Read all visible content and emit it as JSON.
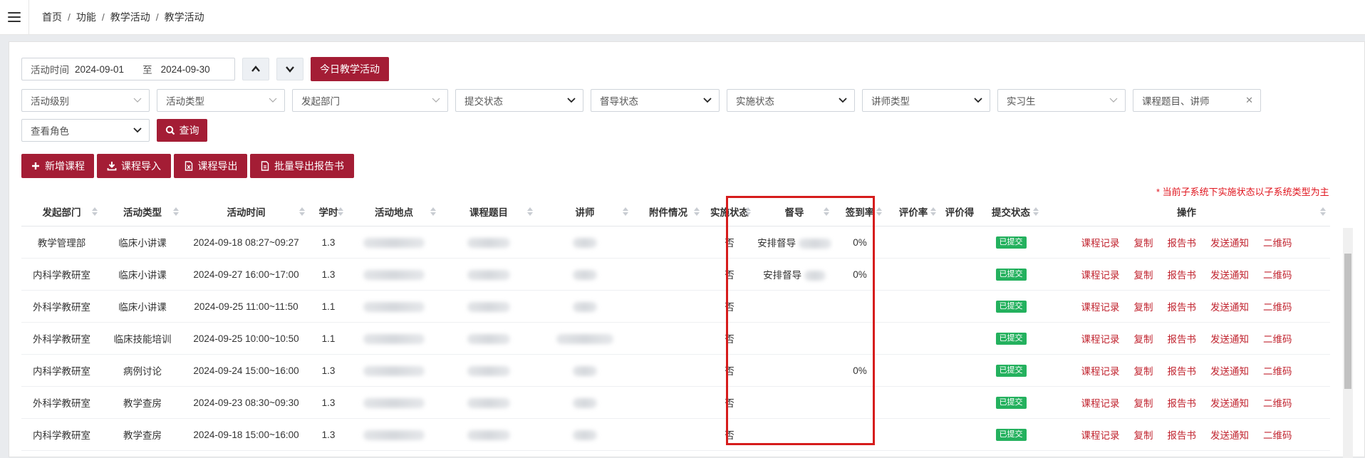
{
  "breadcrumb": {
    "items": [
      "首页",
      "功能",
      "教学活动",
      "教学活动"
    ],
    "separator": "/"
  },
  "filters": {
    "date_label": "活动时间",
    "date_start": "2024-09-01",
    "date_to": "至",
    "date_end": "2024-09-30",
    "today_button": "今日教学活动",
    "selects": [
      "活动级别",
      "活动类型",
      "发起部门",
      "提交状态",
      "督导状态",
      "实施状态",
      "讲师类型",
      "实习生"
    ],
    "search_placeholder": "课程题目、讲师",
    "role_select": "查看角色",
    "query_button": "查询"
  },
  "toolbar": {
    "add": "新增课程",
    "import": "课程导入",
    "export": "课程导出",
    "batch_export": "批量导出报告书"
  },
  "notice": "* 当前子系统下实施状态以子系统类型为主",
  "table": {
    "headers": [
      "发起部门",
      "活动类型",
      "活动时间",
      "学时",
      "活动地点",
      "课程题目",
      "讲师",
      "附件情况",
      "实施状态",
      "督导",
      "签到率",
      "评价率",
      "评价得",
      "提交状态",
      "操作"
    ],
    "rows": [
      {
        "dept": "教学管理部",
        "type": "临床小讲课",
        "time": "2024-09-18 08:27~09:27",
        "hours": "1.3",
        "status": "否",
        "supervisor": "安排督导",
        "signin": "0%",
        "submit": "已提交"
      },
      {
        "dept": "内科学教研室",
        "type": "临床小讲课",
        "time": "2024-09-27 16:00~17:00",
        "hours": "1.3",
        "status": "否",
        "supervisor": "安排督导",
        "signin": "0%",
        "submit": "已提交"
      },
      {
        "dept": "外科学教研室",
        "type": "临床小讲课",
        "time": "2024-09-25 11:00~11:50",
        "hours": "1.1",
        "status": "否",
        "supervisor": "",
        "signin": "",
        "submit": "已提交"
      },
      {
        "dept": "外科学教研室",
        "type": "临床技能培训",
        "time": "2024-09-25 10:00~10:50",
        "hours": "1.1",
        "status": "否",
        "supervisor": "",
        "signin": "",
        "submit": "已提交"
      },
      {
        "dept": "内科学教研室",
        "type": "病例讨论",
        "time": "2024-09-24 15:00~16:00",
        "hours": "1.3",
        "status": "否",
        "supervisor": "",
        "signin": "0%",
        "submit": "已提交"
      },
      {
        "dept": "外科学教研室",
        "type": "教学查房",
        "time": "2024-09-23 08:30~09:30",
        "hours": "1.3",
        "status": "否",
        "supervisor": "",
        "signin": "",
        "submit": "已提交"
      },
      {
        "dept": "内科学教研室",
        "type": "教学查房",
        "time": "2024-09-18 15:00~16:00",
        "hours": "1.3",
        "status": "否",
        "supervisor": "",
        "signin": "",
        "submit": "已提交"
      }
    ],
    "actions": [
      "课程记录",
      "复制",
      "报告书",
      "发送通知",
      "二维码"
    ]
  },
  "colors": {
    "primary": "#a41d35",
    "link": "#c1242f",
    "badge": "#24b15e",
    "highlight": "#d61c1c"
  },
  "icons": [
    "menu-icon",
    "chevron-up-icon",
    "chevron-down-icon",
    "search-icon",
    "plus-icon",
    "download-icon",
    "excel-icon",
    "file-icon"
  ]
}
